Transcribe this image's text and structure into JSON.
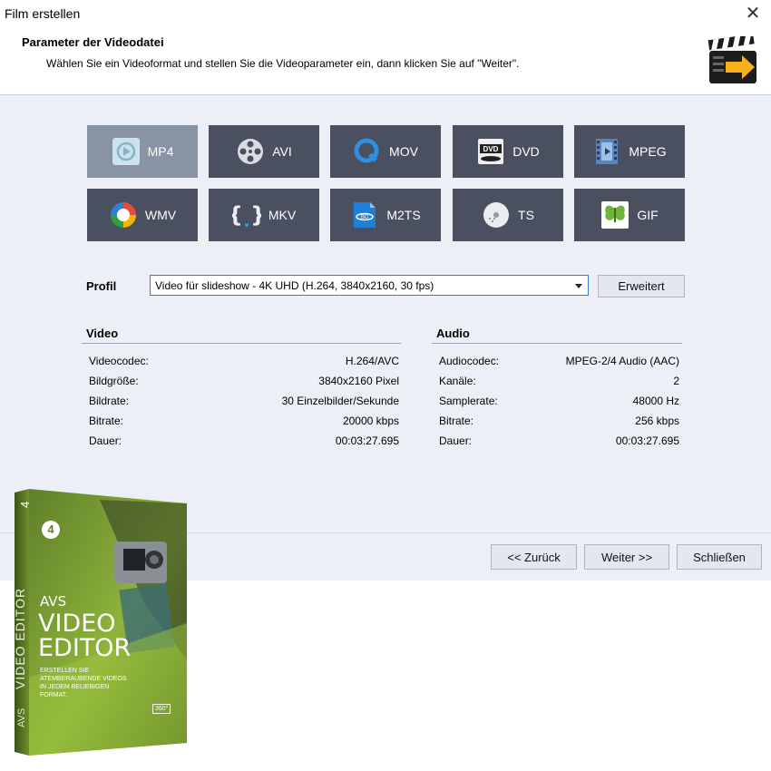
{
  "window": {
    "title": "Film erstellen",
    "close_icon": "close-icon"
  },
  "header": {
    "title": "Parameter der Videodatei",
    "subtitle": "Wählen Sie ein Videoformat und stellen Sie die Videoparameter ein, dann klicken Sie auf \"Weiter\".",
    "icon": "clapperboard-arrow-icon"
  },
  "formats": [
    {
      "label": "MP4",
      "icon": "mp4-icon",
      "selected": true
    },
    {
      "label": "AVI",
      "icon": "film-reel-icon",
      "selected": false
    },
    {
      "label": "MOV",
      "icon": "quicktime-icon",
      "selected": false
    },
    {
      "label": "DVD",
      "icon": "dvd-icon",
      "selected": false
    },
    {
      "label": "MPEG",
      "icon": "film-strip-icon",
      "selected": false
    },
    {
      "label": "WMV",
      "icon": "wmv-icon",
      "selected": false
    },
    {
      "label": "MKV",
      "icon": "mkv-braces-icon",
      "selected": false
    },
    {
      "label": "M2TS",
      "icon": "bluray-icon",
      "selected": false
    },
    {
      "label": "TS",
      "icon": "disc-icon",
      "selected": false
    },
    {
      "label": "GIF",
      "icon": "butterfly-icon",
      "selected": false
    }
  ],
  "profile": {
    "label": "Profil",
    "value": "Video für slideshow - 4K UHD (H.264, 3840x2160, 30 fps)",
    "advanced_button": "Erweitert"
  },
  "video": {
    "title": "Video",
    "rows": [
      {
        "key": "Videocodec:",
        "value": "H.264/AVC"
      },
      {
        "key": "Bildgröße:",
        "value": "3840x2160 Pixel"
      },
      {
        "key": "Bildrate:",
        "value": "30 Einzelbilder/Sekunde"
      },
      {
        "key": "Bitrate:",
        "value": "20000 kbps"
      },
      {
        "key": "Dauer:",
        "value": "00:03:27.695"
      }
    ]
  },
  "audio": {
    "title": "Audio",
    "rows": [
      {
        "key": "Audiocodec:",
        "value": "MPEG-2/4 Audio (AAC)"
      },
      {
        "key": "Kanäle:",
        "value": "2"
      },
      {
        "key": "Samplerate:",
        "value": "48000 Hz"
      },
      {
        "key": "Bitrate:",
        "value": "256 kbps"
      },
      {
        "key": "Dauer:",
        "value": "00:03:27.695"
      }
    ]
  },
  "footer": {
    "back": "<< Zurück",
    "next": "Weiter >>",
    "close": "Schließen"
  },
  "product_box": {
    "brand": "AVS",
    "title_line1": "VIDEO",
    "title_line2": "EDITOR",
    "spine": "VIDEO EDITOR",
    "spine_brand": "AVS",
    "tagline_line1": "ERSTELLEN SIE",
    "tagline_line2": "ATEMBERAUBENDE VIDEOS",
    "tagline_line3": "IN JEDEM BELIEBIGEN",
    "tagline_line4": "FORMAT.",
    "logo_text": "4",
    "badge": "360°",
    "colors": {
      "green": "#7fa82e",
      "dark": "#2d3a1c"
    }
  },
  "colors": {
    "tile": "#4a5060",
    "tile_selected": "#8894a6",
    "panel": "#eceff5",
    "accent": "#3b7ad9"
  }
}
